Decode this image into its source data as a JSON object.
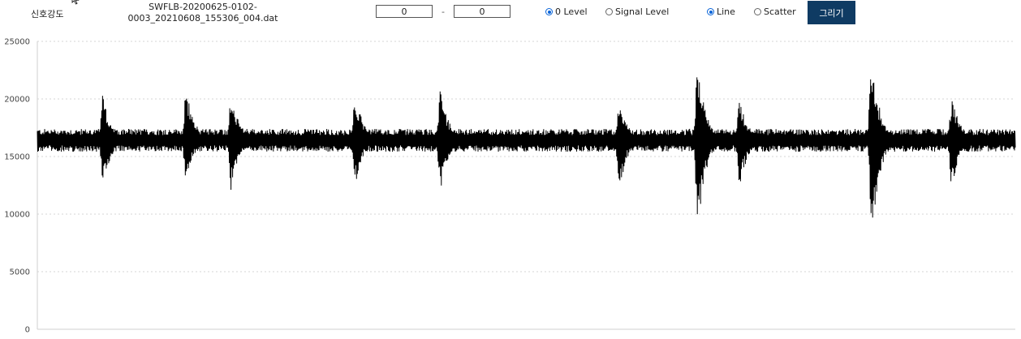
{
  "toolbar": {
    "signal_strength_label": "신호강도",
    "filename_line1": "SWFLB-20200625-0102-",
    "filename_line2": "0003_20210608_155306_004.dat",
    "range_start": "0",
    "range_separator": "-",
    "range_end": "0",
    "radio_zero_level": "0 Level",
    "radio_signal_level": "Signal Level",
    "radio_line": "Line",
    "radio_scatter": "Scatter",
    "draw_button": "그리기",
    "selected_level": "0 Level",
    "selected_style": "Line"
  },
  "colors": {
    "button_bg": "#0f3b63",
    "radio_accent": "#0a64d8",
    "signal": "#000000",
    "grid": "#d6d6d6"
  },
  "chart_data": {
    "type": "line",
    "title": "",
    "xlabel": "",
    "ylabel": "",
    "ylim": [
      0,
      25000
    ],
    "yticks": [
      0,
      5000,
      10000,
      15000,
      20000,
      25000
    ],
    "ytick_labels": [
      "0",
      "5000",
      "10000",
      "15000",
      "20000",
      "25000"
    ],
    "grid": "horizontal dotted",
    "legend": "none",
    "x_samples": 2400,
    "baseline": 16500,
    "noise_amplitude": 900,
    "bursts": [
      {
        "center": 0.067,
        "min": 12000,
        "max": 20600
      },
      {
        "center": 0.152,
        "min": 12300,
        "max": 21200
      },
      {
        "center": 0.198,
        "min": 11900,
        "max": 20700
      },
      {
        "center": 0.325,
        "min": 12400,
        "max": 20700
      },
      {
        "center": 0.412,
        "min": 11800,
        "max": 21200
      },
      {
        "center": 0.595,
        "min": 11700,
        "max": 20400
      },
      {
        "center": 0.675,
        "min": 7400,
        "max": 23800
      },
      {
        "center": 0.718,
        "min": 11700,
        "max": 20200
      },
      {
        "center": 0.853,
        "min": 7500,
        "max": 24200
      },
      {
        "center": 0.935,
        "min": 11800,
        "max": 20500
      }
    ]
  }
}
